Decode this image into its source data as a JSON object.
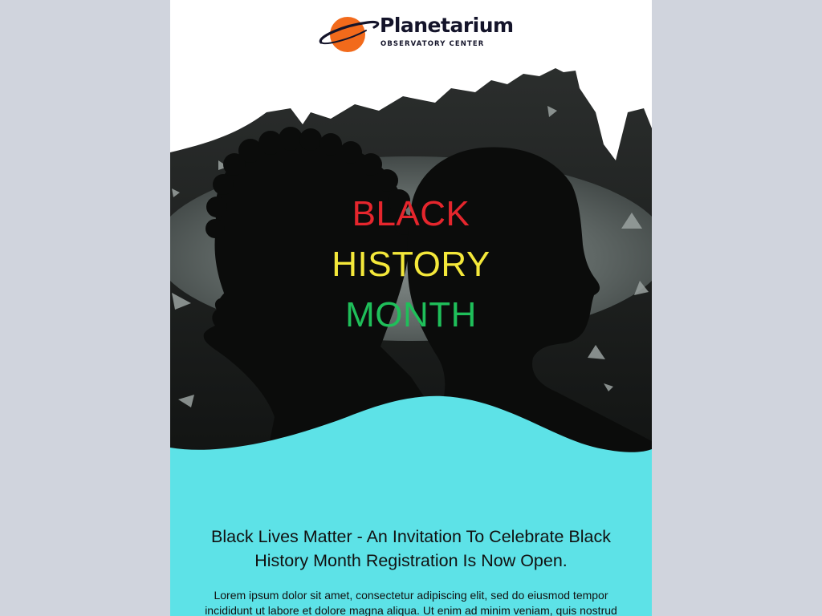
{
  "brand": {
    "name": "Planetarium",
    "tagline": "OBSERVATORY CENTER",
    "planet_color": "#f26a1b"
  },
  "hero": {
    "line1": "BLACK",
    "line2": "HISTORY",
    "line3": "MONTH",
    "colors": {
      "line1": "#e5262d",
      "line2": "#f4e83a",
      "line3": "#1fbf5a",
      "wave": "#5de2e7"
    }
  },
  "content": {
    "heading": "Black Lives Matter - An Invitation To Celebrate Black History Month Registration Is Now Open.",
    "body": "Lorem ipsum dolor sit amet, consectetur adipiscing elit, sed do eiusmod tempor incididunt ut labore et dolore magna aliqua. Ut enim ad minim veniam, quis nostrud"
  }
}
